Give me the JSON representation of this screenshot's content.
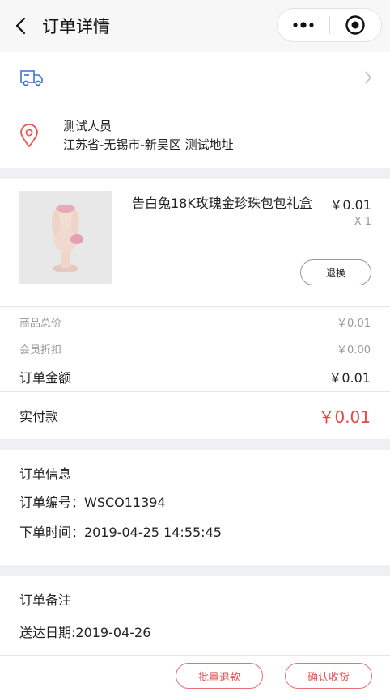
{
  "nav": {
    "title": "订单详情"
  },
  "address": {
    "name": "测试人员",
    "detail": "江苏省-无锡市-新吴区 测试地址"
  },
  "goods": {
    "name": "告白兔18K玫瑰金珍珠包包礼盒",
    "price": "￥0.01",
    "qty": "X 1",
    "refund_label": "退换"
  },
  "summary": {
    "goods_total_label": "商品总价",
    "goods_total_value": "￥0.01",
    "member_discount_label": "会员折扣",
    "member_discount_value": "￥0.00",
    "order_amount_label": "订单金额",
    "order_amount_value": "￥0.01",
    "paid_label": "实付款",
    "paid_value": "￥0.01"
  },
  "order_info": {
    "title": "订单信息",
    "number": "订单编号：WSCO11394",
    "time": "下单时间：2019-04-25 14:55:45"
  },
  "remark": {
    "title": "订单备注",
    "delivery": "送达日期:2019-04-26"
  },
  "footer": {
    "batch_refund_label": "批量退款",
    "confirm_label": "确认收货"
  },
  "colors": {
    "accent": "#ee4444",
    "logistics_icon": "#3b6fd4"
  }
}
